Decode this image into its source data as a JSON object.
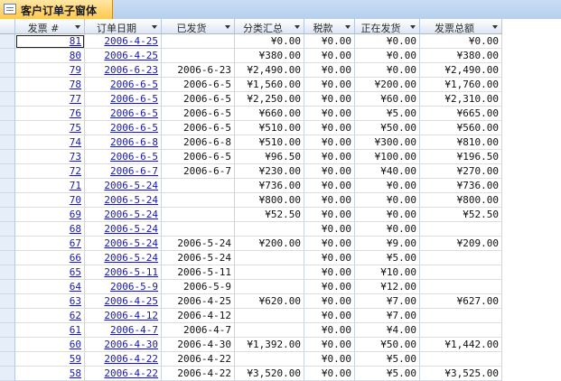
{
  "window": {
    "title": "客户订单子窗体",
    "icon": "form-icon"
  },
  "columns": [
    "发票 #",
    "订单日期",
    "已发货",
    "分类汇总",
    "税款",
    "正在发货",
    "发票总额"
  ],
  "rows": [
    [
      "81",
      "2006-4-25",
      "",
      "¥0.00",
      "¥0.00",
      "¥0.00",
      "¥0.00"
    ],
    [
      "80",
      "2006-4-25",
      "",
      "¥380.00",
      "¥0.00",
      "¥0.00",
      "¥380.00"
    ],
    [
      "79",
      "2006-6-23",
      "2006-6-23",
      "¥2,490.00",
      "¥0.00",
      "¥0.00",
      "¥2,490.00"
    ],
    [
      "78",
      "2006-6-5",
      "2006-6-5",
      "¥1,560.00",
      "¥0.00",
      "¥200.00",
      "¥1,760.00"
    ],
    [
      "77",
      "2006-6-5",
      "2006-6-5",
      "¥2,250.00",
      "¥0.00",
      "¥60.00",
      "¥2,310.00"
    ],
    [
      "76",
      "2006-6-5",
      "2006-6-5",
      "¥660.00",
      "¥0.00",
      "¥5.00",
      "¥665.00"
    ],
    [
      "75",
      "2006-6-5",
      "2006-6-5",
      "¥510.00",
      "¥0.00",
      "¥50.00",
      "¥560.00"
    ],
    [
      "74",
      "2006-6-8",
      "2006-6-8",
      "¥510.00",
      "¥0.00",
      "¥300.00",
      "¥810.00"
    ],
    [
      "73",
      "2006-6-5",
      "2006-6-5",
      "¥96.50",
      "¥0.00",
      "¥100.00",
      "¥196.50"
    ],
    [
      "72",
      "2006-6-7",
      "2006-6-7",
      "¥230.00",
      "¥0.00",
      "¥40.00",
      "¥270.00"
    ],
    [
      "71",
      "2006-5-24",
      "",
      "¥736.00",
      "¥0.00",
      "¥0.00",
      "¥736.00"
    ],
    [
      "70",
      "2006-5-24",
      "",
      "¥800.00",
      "¥0.00",
      "¥0.00",
      "¥800.00"
    ],
    [
      "69",
      "2006-5-24",
      "",
      "¥52.50",
      "¥0.00",
      "¥0.00",
      "¥52.50"
    ],
    [
      "68",
      "2006-5-24",
      "",
      "",
      "¥0.00",
      "¥0.00",
      ""
    ],
    [
      "67",
      "2006-5-24",
      "2006-5-24",
      "¥200.00",
      "¥0.00",
      "¥9.00",
      "¥209.00"
    ],
    [
      "66",
      "2006-5-24",
      "2006-5-24",
      "",
      "¥0.00",
      "¥5.00",
      ""
    ],
    [
      "65",
      "2006-5-11",
      "2006-5-11",
      "",
      "¥0.00",
      "¥10.00",
      ""
    ],
    [
      "64",
      "2006-5-9",
      "2006-5-9",
      "",
      "¥0.00",
      "¥12.00",
      ""
    ],
    [
      "63",
      "2006-4-25",
      "2006-4-25",
      "¥620.00",
      "¥0.00",
      "¥7.00",
      "¥627.00"
    ],
    [
      "62",
      "2006-4-12",
      "2006-4-12",
      "",
      "¥0.00",
      "¥7.00",
      ""
    ],
    [
      "61",
      "2006-4-7",
      "2006-4-7",
      "",
      "¥0.00",
      "¥4.00",
      ""
    ],
    [
      "60",
      "2006-4-30",
      "2006-4-30",
      "¥1,392.00",
      "¥0.00",
      "¥50.00",
      "¥1,442.00"
    ],
    [
      "59",
      "2006-4-22",
      "2006-4-22",
      "",
      "¥0.00",
      "¥5.00",
      ""
    ],
    [
      "58",
      "2006-4-22",
      "2006-4-22",
      "¥3,520.00",
      "¥0.00",
      "¥5.00",
      "¥3,525.00"
    ]
  ]
}
